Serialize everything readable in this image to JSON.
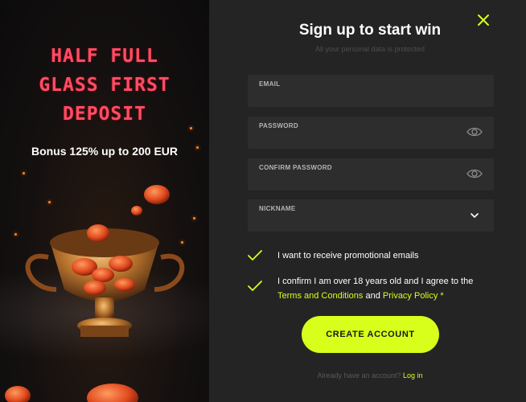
{
  "promo": {
    "title_lines": [
      "HALF FULL",
      "GLASS FIRST",
      "DEPOSIT"
    ],
    "bonus_text": "Bonus 125% up to 200 EUR"
  },
  "form": {
    "title": "Sign up to start win",
    "subtitle": "All your personal data is protected",
    "close_icon": "close-x-icon",
    "fields": {
      "email": {
        "label": "EMAIL",
        "value": ""
      },
      "password": {
        "label": "PASSWORD",
        "value": "",
        "icon": "eye-icon"
      },
      "confirm_password": {
        "label": "CONFIRM PASSWORD",
        "value": "",
        "icon": "eye-icon"
      },
      "nickname": {
        "label": "NICKNAME",
        "value": "",
        "icon": "chevron-down-icon"
      }
    },
    "checkboxes": {
      "promo_emails": {
        "label": "I want to receive promotional emails",
        "checked": true
      },
      "age_terms": {
        "text_before": "I confirm I am over 18 years old and I agree to the",
        "terms_link": "Terms and Conditions",
        "and_text": "and",
        "privacy_link": "Privacy Policy *",
        "checked": true
      }
    },
    "submit_label": "CREATE ACCOUNT",
    "login_prompt": "Already have an account?",
    "login_link": "Log in"
  },
  "colors": {
    "accent": "#d7ff1b",
    "promo_title": "#ff4d63",
    "panel_bg": "#242424",
    "field_bg": "#2d2d2d"
  }
}
